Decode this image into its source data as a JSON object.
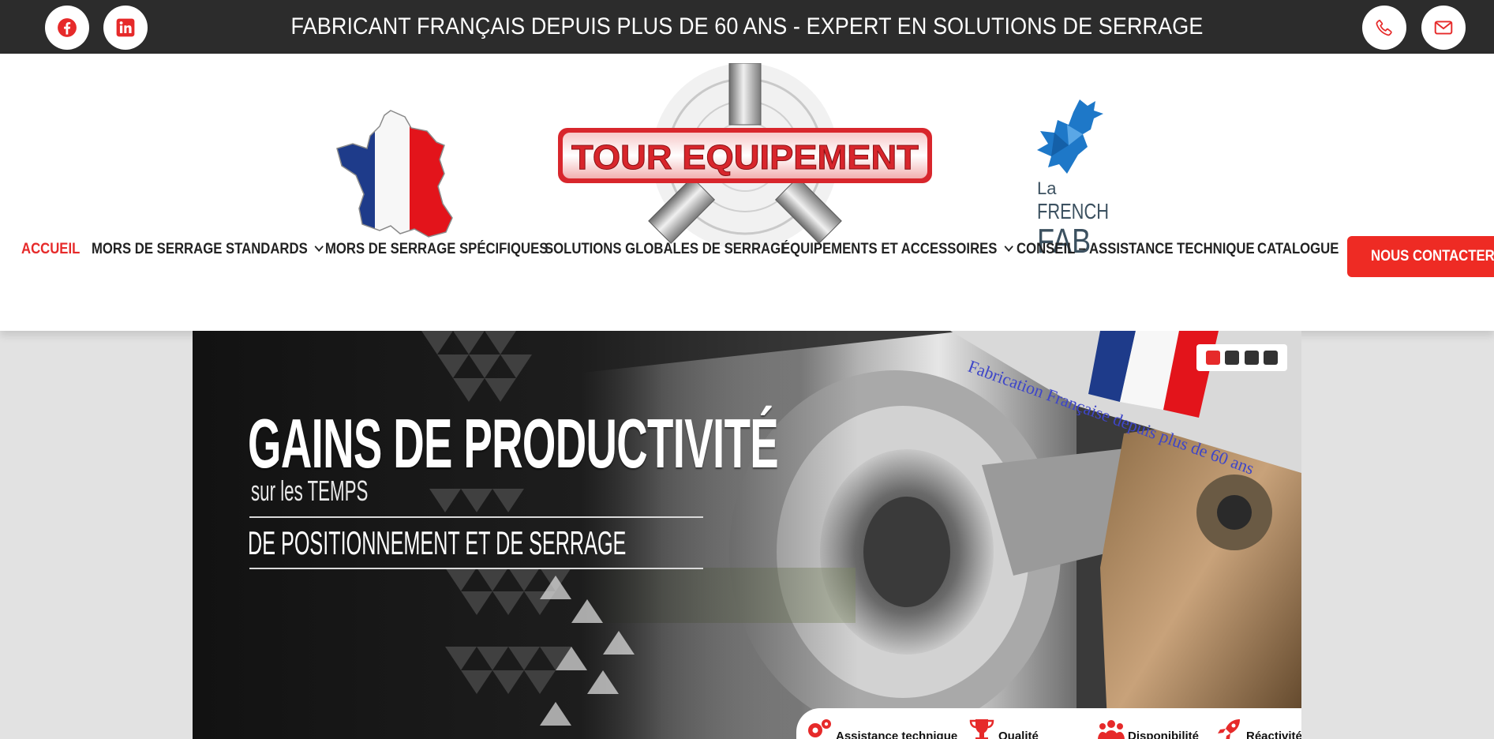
{
  "topbar": {
    "text": "FABRICANT FRANÇAIS DEPUIS PLUS DE 60 ANS - EXPERT EN SOLUTIONS DE SERRAGE",
    "social": [
      "facebook-icon",
      "linkedin-icon"
    ],
    "contact": [
      "phone-icon",
      "mail-icon"
    ],
    "icon_color": "#e62a2a"
  },
  "header": {
    "logo_text": "TOUR EQUIPEMENT",
    "frenchfab": {
      "line1": "La",
      "line2": "FRENCH",
      "line3": "FAB"
    }
  },
  "nav": {
    "items": [
      {
        "label": "ACCUEIL",
        "active": true,
        "dropdown": false
      },
      {
        "label": "MORS DE SERRAGE STANDARDS",
        "active": false,
        "dropdown": true
      },
      {
        "label": "MORS DE SERRAGE SPÉCIFIQUES",
        "active": false,
        "dropdown": false
      },
      {
        "label": "SOLUTIONS GLOBALES DE SERRAGE",
        "active": false,
        "dropdown": false
      },
      {
        "label": "ÉQUIPEMENTS ET ACCESSOIRES",
        "active": false,
        "dropdown": true
      },
      {
        "label": "CONSEIL – ASSISTANCE TECHNIQUE",
        "active": false,
        "dropdown": false
      },
      {
        "label": "CATALOGUE",
        "active": false,
        "dropdown": false
      }
    ],
    "cta_label": "NOUS CONTACTER",
    "accent": "#ee2b24"
  },
  "hero": {
    "title": "GAINS DE PRODUCTIVITÉ",
    "subtitle1": "sur les TEMPS",
    "subtitle2": "DE POSITIONNEMENT ET DE SERRAGE",
    "fabrication": "Fabrication Française depuis plus de 60 ans",
    "slides": 4,
    "active_slide": 1,
    "features": [
      "Assistance technique",
      "Qualité",
      "Disponibilité",
      "Réactivité"
    ]
  }
}
